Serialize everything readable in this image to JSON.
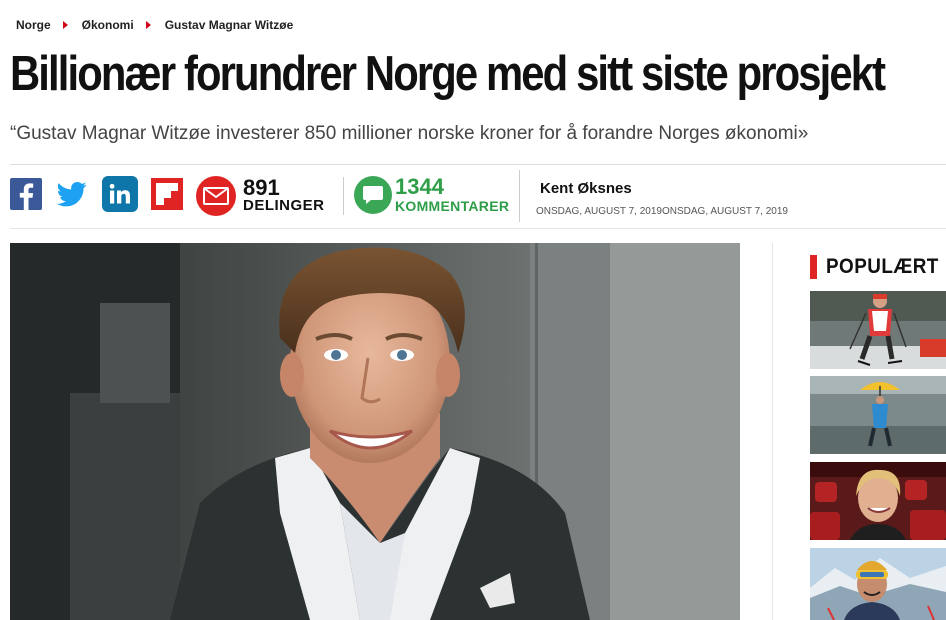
{
  "breadcrumb": [
    "Norge",
    "Økonomi",
    "Gustav Magnar Witzøe"
  ],
  "headline": "Billionær forundrer Norge med sitt siste prosjekt",
  "lead": "“Gustav Magnar Witzøe investerer 850 millioner norske kroner for å forandre Norges økonomi»",
  "share": {
    "icons": [
      "facebook-icon",
      "twitter-icon",
      "linkedin-icon",
      "flipboard-icon",
      "email-icon"
    ],
    "shares_count": "891",
    "shares_label": "DELINGER",
    "comments_count": "1344",
    "comments_label": "KOMMENTARER"
  },
  "author": {
    "name": "Kent Øksnes",
    "date1": "ONSDAG, AUGUST 7, 2019",
    "date2": "ONSDAG, AUGUST 7, 2019"
  },
  "sidebar": {
    "title": "POPULÆRT",
    "thumbnails": [
      "skier-thumbnail",
      "umbrella-walker-thumbnail",
      "smiling-woman-thumbnail",
      "goggles-man-thumbnail"
    ]
  },
  "colors": {
    "accent": "#e02424",
    "facebook": "#3b5998",
    "twitter": "#1da1f2",
    "linkedin": "#0e76a8",
    "comments": "#2e9e48"
  }
}
